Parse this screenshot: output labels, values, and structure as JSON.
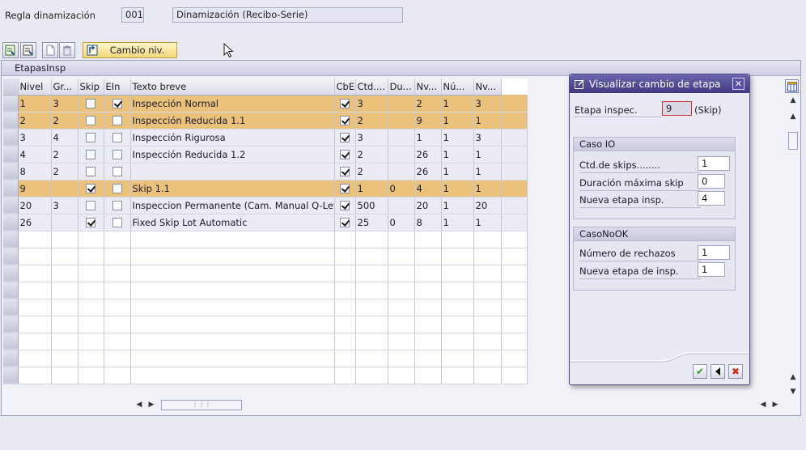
{
  "header": {
    "regla_label": "Regla dinamización",
    "regla_code": "001",
    "regla_desc": "Dinamización (Recibo-Serie)"
  },
  "toolbar": {
    "cambio_label": "Cambio niv."
  },
  "table": {
    "title": "EtapasInsp",
    "columns": [
      "Nivel",
      "Gr...",
      "Skip",
      "EIn",
      "Texto breve",
      "CbE",
      "Ctd....",
      "Du...",
      "Nv...",
      "Nú...",
      "Nv..."
    ],
    "rows": [
      {
        "nivel": "1",
        "gr": "3",
        "skip": false,
        "ein": true,
        "texto": "Inspección Normal",
        "cbe": true,
        "ctd": "3",
        "du": "",
        "nv1": "2",
        "nu": "1",
        "nv2": "3",
        "highlight": true
      },
      {
        "nivel": "2",
        "gr": "2",
        "skip": false,
        "ein": false,
        "texto": "Inspección Reducida 1.1",
        "cbe": true,
        "ctd": "2",
        "du": "",
        "nv1": "9",
        "nu": "1",
        "nv2": "1",
        "highlight": true
      },
      {
        "nivel": "3",
        "gr": "4",
        "skip": false,
        "ein": false,
        "texto": "Inspección Rigurosa",
        "cbe": true,
        "ctd": "3",
        "du": "",
        "nv1": "1",
        "nu": "1",
        "nv2": "3",
        "highlight": false
      },
      {
        "nivel": "4",
        "gr": "2",
        "skip": false,
        "ein": false,
        "texto": "Inspección Reducida 1.2",
        "cbe": true,
        "ctd": "2",
        "du": "",
        "nv1": "26",
        "nu": "1",
        "nv2": "1",
        "highlight": false
      },
      {
        "nivel": "8",
        "gr": "2",
        "skip": false,
        "ein": false,
        "texto": "",
        "cbe": true,
        "ctd": "2",
        "du": "",
        "nv1": "26",
        "nu": "1",
        "nv2": "1",
        "highlight": false
      },
      {
        "nivel": "9",
        "gr": "",
        "skip": true,
        "ein": false,
        "texto": "Skip 1.1",
        "cbe": true,
        "ctd": "1",
        "du": "0",
        "nv1": "4",
        "nu": "1",
        "nv2": "1",
        "highlight": true
      },
      {
        "nivel": "20",
        "gr": "3",
        "skip": false,
        "ein": false,
        "texto": "Inspeccion Permanente (Cam. Manual Q-Lev",
        "cbe": true,
        "ctd": "500",
        "du": "",
        "nv1": "20",
        "nu": "1",
        "nv2": "20",
        "highlight": false
      },
      {
        "nivel": "26",
        "gr": "",
        "skip": true,
        "ein": false,
        "texto": "Fixed Skip Lot Automatic",
        "cbe": true,
        "ctd": "25",
        "du": "0",
        "nv1": "8",
        "nu": "1",
        "nv2": "1",
        "highlight": false
      }
    ],
    "empty_rows": 9
  },
  "dialog": {
    "title": "Visualizar cambio de etapa",
    "etapa_label": "Etapa inspec.",
    "etapa_value": "9",
    "etapa_suffix": "(Skip)",
    "caso_io": {
      "title": "Caso IO",
      "ctd_skips_label": "Ctd.de skips........",
      "ctd_skips_value": "1",
      "duracion_label": "Duración máxima skip",
      "duracion_value": "0",
      "nueva_label": "Nueva etapa insp.",
      "nueva_value": "4"
    },
    "caso_nook": {
      "title": "CasoNoOK",
      "rechazos_label": "Número de rechazos",
      "rechazos_value": "1",
      "nueva_label": "Nueva etapa de insp.",
      "nueva_value": "1"
    }
  },
  "colors": {
    "highlight_row": "#eac27c",
    "dialog_title": "#4a4590",
    "accept_green": "#2e9a1f",
    "cancel_red": "#c8301e"
  }
}
